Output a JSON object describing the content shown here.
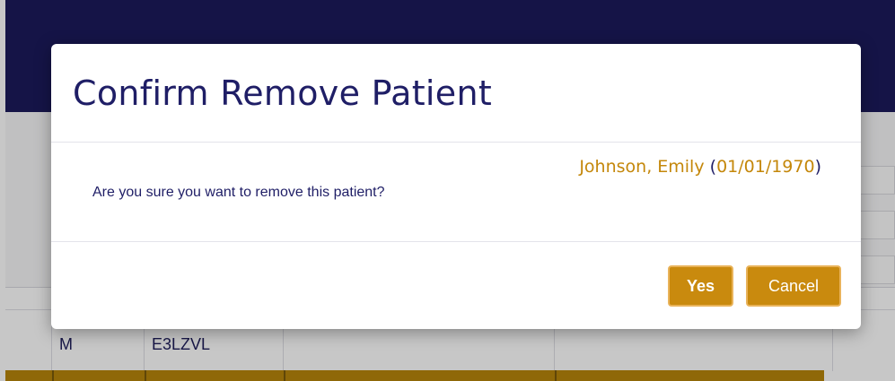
{
  "background": {
    "table_row": {
      "cells": [
        "M",
        "E3LZVL"
      ]
    }
  },
  "modal": {
    "title": "Confirm Remove Patient",
    "patient_name": "Johnson, Emily",
    "patient_open_paren": "(",
    "patient_dob": "01/01/1970",
    "patient_close_paren": ")",
    "message": "Are you sure you want to remove this patient?",
    "yes_label": "Yes",
    "cancel_label": "Cancel"
  },
  "colors": {
    "navy": "#1f1e66",
    "gold": "#c98a0e",
    "topbar": "#1b1a5c"
  }
}
